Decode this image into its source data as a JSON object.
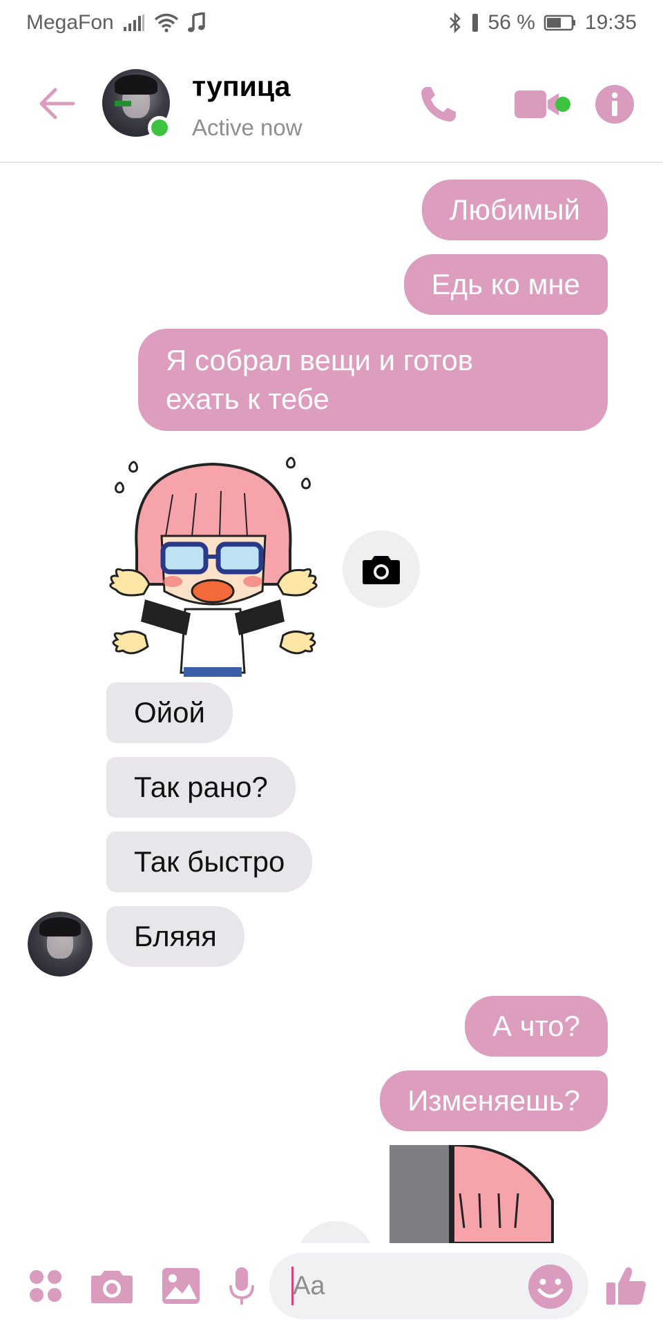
{
  "status_bar": {
    "carrier": "MegaFon",
    "battery": "56 %",
    "time": "19:35"
  },
  "header": {
    "contact_name": "тупица",
    "contact_status": "Active now"
  },
  "messages": {
    "out_1": "Любимый",
    "out_2": "Едь ко мне",
    "out_3_line1": "Я собрал вещи и готов",
    "out_3_line2": "ехать к тебе",
    "in_1": "Ойой",
    "in_2": "Так рано?",
    "in_3": "Так быстро",
    "in_4": "Бляяя",
    "out_4": "А что?",
    "out_5": "Изменяешь?"
  },
  "composer": {
    "placeholder": "Aa"
  },
  "colors": {
    "accent": "#d99cbf",
    "outgoing_bubble": "#dc9dbf",
    "incoming_bubble": "#e8e6ea",
    "online": "#3ec341"
  },
  "icons": {
    "back": "arrow-left-icon",
    "call": "phone-icon",
    "video": "video-camera-icon",
    "info": "info-icon",
    "apps": "four-dots-icon",
    "camera": "camera-icon",
    "gallery": "image-icon",
    "mic": "microphone-icon",
    "emoji": "smiley-icon",
    "like": "thumbs-up-icon"
  }
}
